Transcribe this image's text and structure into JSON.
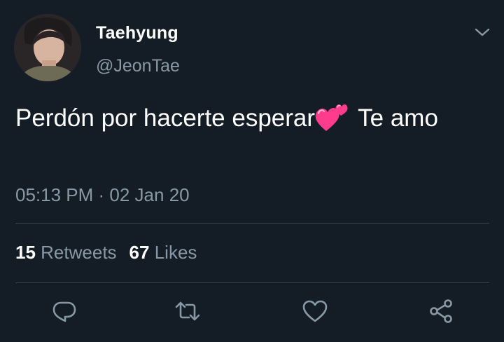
{
  "user": {
    "display_name": "Taehyung",
    "handle": "@JeonTae",
    "avatar_icon": "profile-photo"
  },
  "tweet": {
    "text_before_emoji": "Perdón por hacerte esperar",
    "emoji": "two-hearts-emoji",
    "text_after_emoji": " Te amo",
    "time": "05:13 PM",
    "separator": " · ",
    "date": "02 Jan 20"
  },
  "stats": {
    "retweets_count": "15",
    "retweets_label": "Retweets",
    "likes_count": "67",
    "likes_label": "Likes"
  },
  "actions": [
    "reply-icon",
    "retweet-icon",
    "like-icon",
    "share-icon"
  ],
  "colors": {
    "background": "#141d26",
    "secondary_text": "#8899a6",
    "divider": "#38444d",
    "emoji_pink": "#ff3b8e"
  }
}
